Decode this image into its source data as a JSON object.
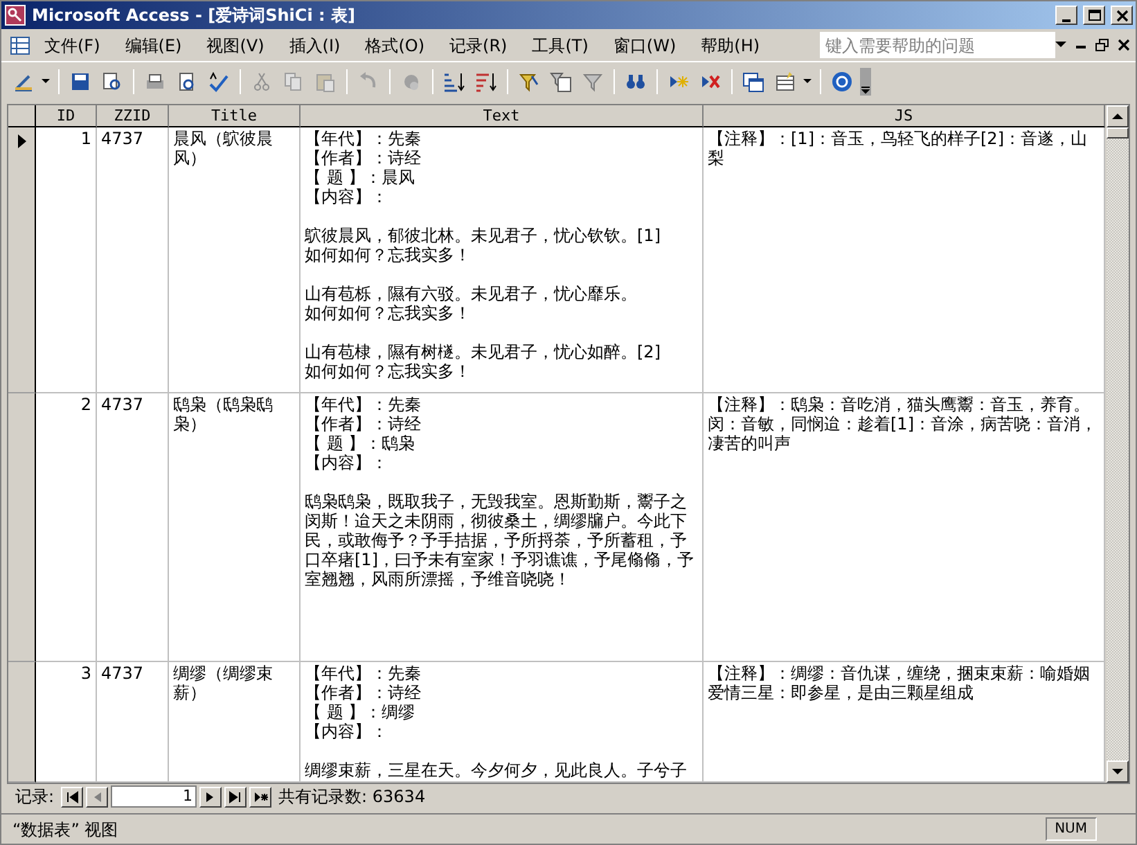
{
  "window": {
    "title": "Microsoft Access - [爱诗词ShiCi : 表]"
  },
  "menu": [
    "文件(F)",
    "编辑(E)",
    "视图(V)",
    "插入(I)",
    "格式(O)",
    "记录(R)",
    "工具(T)",
    "窗口(W)",
    "帮助(H)"
  ],
  "help_box": {
    "placeholder": "键入需要帮助的问题"
  },
  "table": {
    "columns": [
      "ID",
      "ZZID",
      "Title",
      "Text",
      "JS"
    ],
    "rows": [
      {
        "current": true,
        "id": "1",
        "zzid": "4737",
        "title": "晨风（鴥彼晨风）",
        "text": [
          [
            "【年代】：先秦",
            "【作者】：诗经",
            "【 题 】：晨风",
            "【内容】："
          ],
          [
            "鴥彼晨风，郁彼北林。未见君子，忧心钦钦。[1]",
            "如何如何？忘我实多！"
          ],
          [
            "山有苞栎，隰有六驳。未见君子，忧心靡乐。",
            "如何如何？忘我实多！"
          ],
          [
            "山有苞棣，隰有树檖。未见君子，忧心如醉。[2]",
            "如何如何？忘我实多！"
          ]
        ],
        "js": "【注释】：[1]：音玉，鸟轻飞的样子[2]：音遂，山梨"
      },
      {
        "current": false,
        "id": "2",
        "zzid": "4737",
        "title": "鸱枭（鸱枭鸱枭）",
        "text": [
          [
            "【年代】：先秦",
            "【作者】：诗经",
            "【 题 】：鸱枭",
            "【内容】："
          ],
          [
            "鸱枭鸱枭，既取我子，无毁我室。恩斯勤斯，鬻子之闵斯！迨天之未阴雨，彻彼桑土，绸缪牖户。今此下民，或敢侮予？予手拮据，予所捋荼，予所蓄租，予口卒瘏[1]，曰予未有室家！予羽谯谯，予尾翛翛，予室翘翘，风雨所漂摇，予维音哓哓！"
          ]
        ],
        "js": "【注释】：鸱枭：音吃消，猫头鹰鬻：音玉，养育。闵：音敏，同悯迨：趁着[1]：音涂，病苦哓：音消，凄苦的叫声"
      },
      {
        "current": false,
        "id": "3",
        "zzid": "4737",
        "title": "绸缪（绸缪束薪）",
        "text": [
          [
            "【年代】：先秦",
            "【作者】：诗经",
            "【 题 】：绸缪",
            "【内容】："
          ],
          [
            "绸缪束薪，三星在天。今夕何夕，见此良人。子兮子"
          ]
        ],
        "js": "【注释】：绸缪：音仇谋，缠绕，捆束束薪：喻婚姻爱情三星：即参星，是由三颗星组成"
      }
    ]
  },
  "navigation": {
    "label": "记录:",
    "record": "1",
    "total": "共有记录数: 63634"
  },
  "status_bar": {
    "view": "“数据表” 视图",
    "indicator": "NUM"
  }
}
